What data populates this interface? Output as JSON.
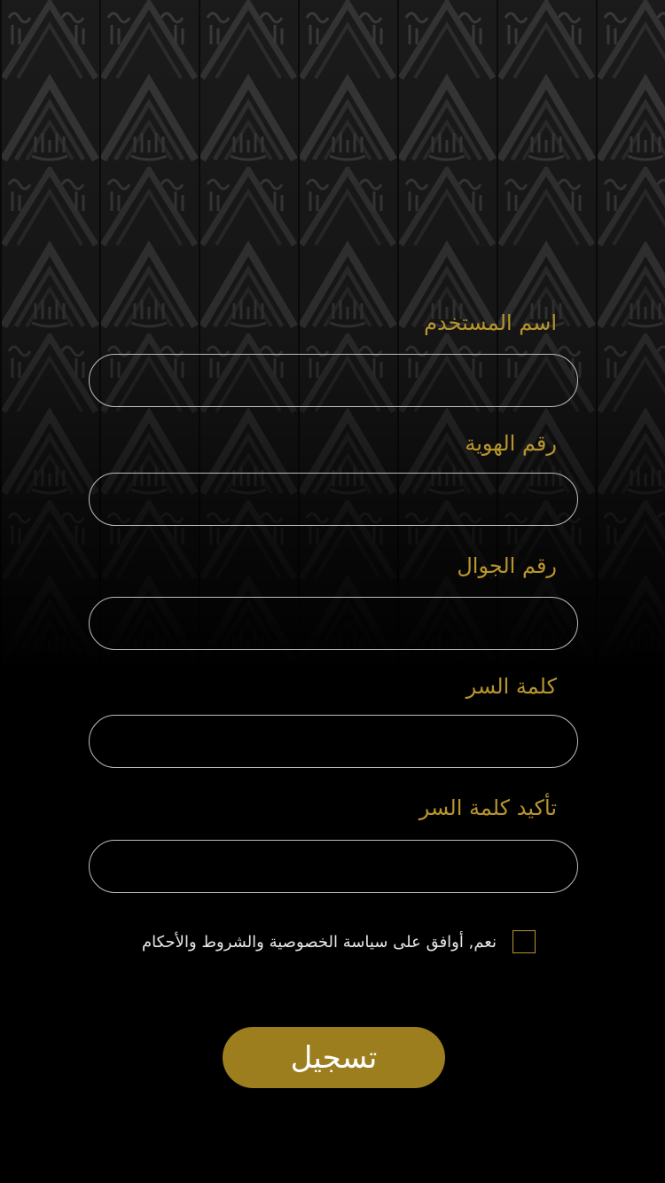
{
  "form": {
    "fields": [
      {
        "label": "اسم المستخدم",
        "value": "",
        "placeholder": ""
      },
      {
        "label": "رقم الهوية",
        "value": "",
        "placeholder": ""
      },
      {
        "label": "رقم الجوال",
        "value": "",
        "placeholder": ""
      },
      {
        "label": "كلمة السر",
        "value": "",
        "placeholder": ""
      },
      {
        "label": "تأكيد كلمة السر",
        "value": "",
        "placeholder": ""
      }
    ],
    "agree_text": "نعم, أوافق على سياسة الخصوصية والشروط والأحكام",
    "agree_checked": false,
    "submit_label": "تسجيل"
  },
  "colors": {
    "background": "#000000",
    "label_gold": "#b8952c",
    "button_gold": "#9c7e1f",
    "input_border": "#bdbdbd"
  },
  "background_pattern": "kiswah-calligraphy-pattern"
}
